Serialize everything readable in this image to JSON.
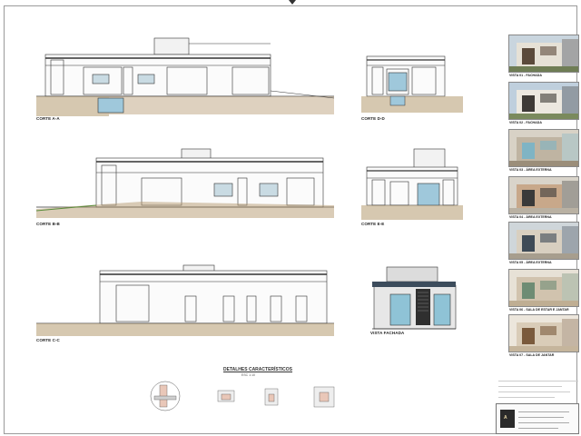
{
  "sections": {
    "aa": "CORTE A-A",
    "dd": "CORTE D-D",
    "bb": "CORTE B-B",
    "ee": "CORTE E-E",
    "cc": "CORTE C-C",
    "fachada": "VISTA FACHADA"
  },
  "details": {
    "title": "DETALHES CARACTERÍSTICOS",
    "scale": "ESC 1:10"
  },
  "views": [
    {
      "label": "VISTA 01 - FACHADA",
      "palette": {
        "sky": "#c9d5de",
        "wall": "#e6e1d6",
        "accent": "#5b4a3b",
        "ground": "#6f7d55"
      }
    },
    {
      "label": "VISTA 02 - FACHADA",
      "palette": {
        "sky": "#bfcfdd",
        "wall": "#ece8df",
        "accent": "#3e3a36",
        "ground": "#7a8a5d"
      }
    },
    {
      "label": "VISTA 03 - ÁREA EXTERNA",
      "palette": {
        "sky": "#d8d2c6",
        "wall": "#bfb4a2",
        "accent": "#7fb4c4",
        "ground": "#9b8e7a"
      }
    },
    {
      "label": "VISTA 04 - ÁREA EXTERNA",
      "palette": {
        "sky": "#d9d4ca",
        "wall": "#c8a88a",
        "accent": "#3a3a3a",
        "ground": "#b9b1a3"
      }
    },
    {
      "label": "VISTA 05 - ÁREA EXTERNA",
      "palette": {
        "sky": "#cfd6da",
        "wall": "#d8cfc0",
        "accent": "#3e4a56",
        "ground": "#a79e8e"
      }
    },
    {
      "label": "VISTA 06 - SALA DE ESTAR E JANTAR",
      "palette": {
        "sky": "#e7e1d6",
        "wall": "#d1c3ae",
        "accent": "#6e8c74",
        "ground": "#bfae93"
      }
    },
    {
      "label": "VISTA 07 - SALA DE JANTAR",
      "palette": {
        "sky": "#ece6dc",
        "wall": "#d9ccb8",
        "accent": "#7a5a3c",
        "ground": "#c5b59c"
      }
    }
  ]
}
